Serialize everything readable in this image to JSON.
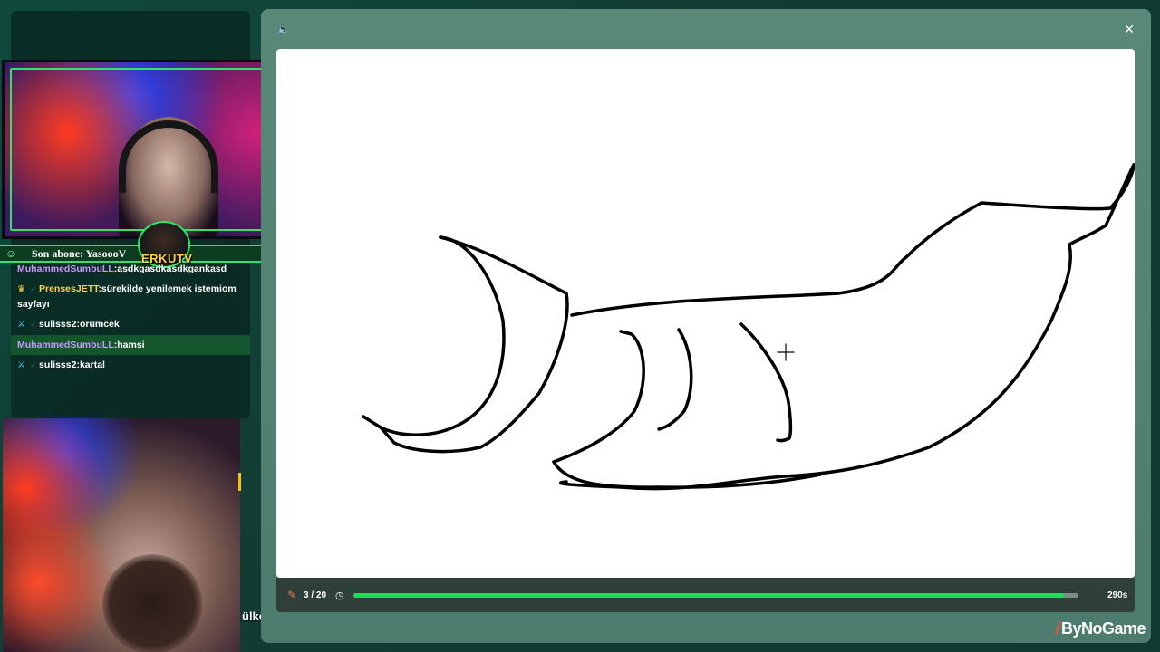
{
  "stream": {
    "new_sub_label": "Son abone: YasoooV",
    "streamer_name": "ERKUTV",
    "caption": "ülkeyi salladı"
  },
  "chat": {
    "messages": [
      {
        "user": "MuhammedSumbuLL",
        "text": ":asdkgasdkasdkgankasd",
        "color": "purple",
        "highlight": false,
        "badge": ""
      },
      {
        "user": "PrensesJETT",
        "text": ":sürekilde yenilemek istemiom sayfayı",
        "color": "yellow",
        "highlight": false,
        "badge": "crown"
      },
      {
        "user": "sulisss2",
        "text": ":örümcek",
        "color": "white",
        "highlight": false,
        "badge": "sword"
      },
      {
        "user": "MuhammedSumbuLL",
        "text": ":hamsi",
        "color": "purple",
        "highlight": true,
        "badge": ""
      },
      {
        "user": "sulisss2",
        "text": ":kartal",
        "color": "white",
        "highlight": false,
        "badge": "sword"
      }
    ]
  },
  "game": {
    "round": "3 / 20",
    "time_left": "290s",
    "progress_fraction": 0.98,
    "progress_color": "#1fdc5a",
    "icons": {
      "sound": "speaker-icon",
      "close": "close-icon",
      "pencil": "pencil-icon",
      "timer": "timer-icon"
    }
  },
  "brand": {
    "name": "ByNoGame",
    "accent": "#ff4b3a"
  }
}
